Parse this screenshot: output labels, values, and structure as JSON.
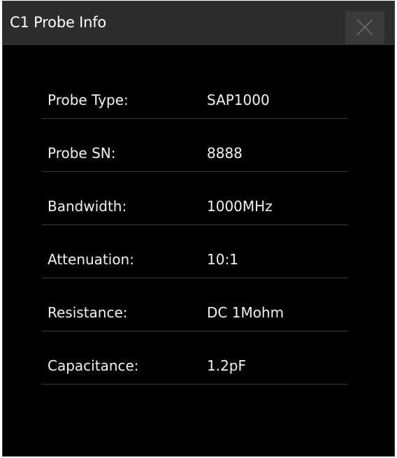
{
  "dialog": {
    "title": "C1 Probe Info",
    "close_icon": "close-icon"
  },
  "probe_info": [
    {
      "label": "Probe Type:",
      "value": "SAP1000"
    },
    {
      "label": "Probe SN:",
      "value": "8888"
    },
    {
      "label": "Bandwidth:",
      "value": "1000MHz"
    },
    {
      "label": "Attenuation:",
      "value": "10:1"
    },
    {
      "label": "Resistance:",
      "value": "DC 1Mohm"
    },
    {
      "label": "Capacitance:",
      "value": "1.2pF"
    }
  ],
  "colors": {
    "background": "#000000",
    "titlebar": "#2c2c2c",
    "text": "#f2f2f2",
    "divider": "#3a3a3a"
  }
}
